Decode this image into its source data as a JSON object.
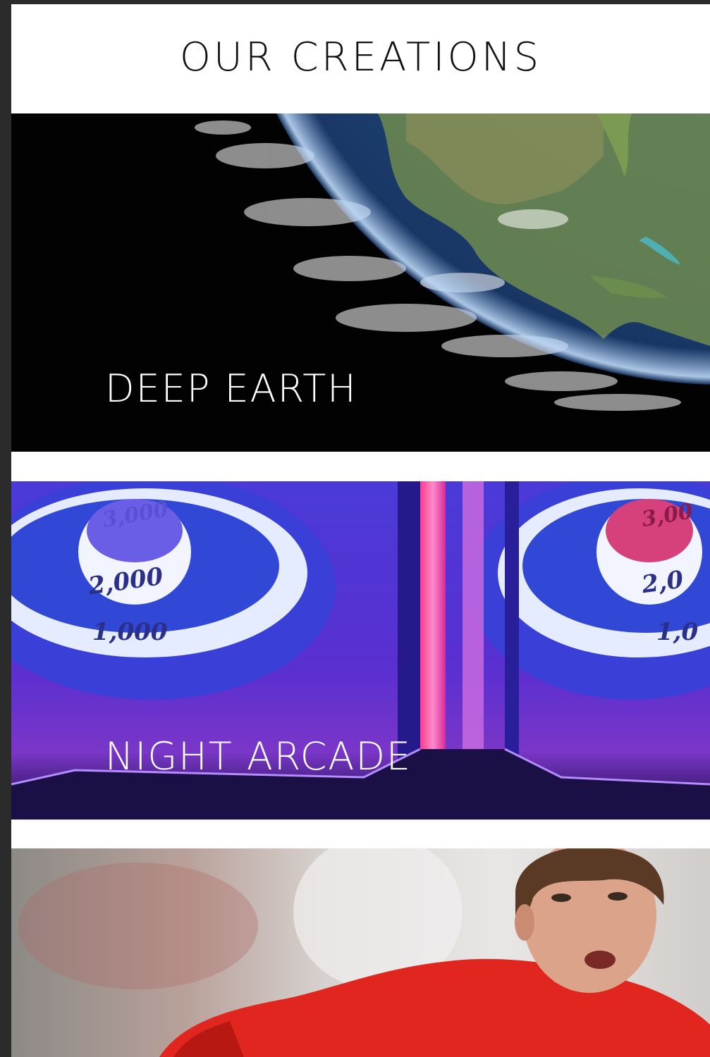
{
  "page": {
    "title": "OUR CREATIONS"
  },
  "cards": [
    {
      "label": "DEEP EARTH",
      "image": "earth-from-space-photo"
    },
    {
      "label": "NIGHT ARCADE",
      "image": "skee-ball-arcade-photo"
    },
    {
      "label": "",
      "image": "soccer-player-photo"
    }
  ],
  "arcade_image_text": {
    "left_top": "3,000",
    "left_mid": "2,000",
    "left_low": "1,000",
    "right_top": "3,00",
    "right_mid": "2,0",
    "right_low": "1,0"
  },
  "colors": {
    "page_bg": "#2b2b2b",
    "content_bg": "#ffffff",
    "title_text": "#111111",
    "label_text": "#ffffff"
  }
}
